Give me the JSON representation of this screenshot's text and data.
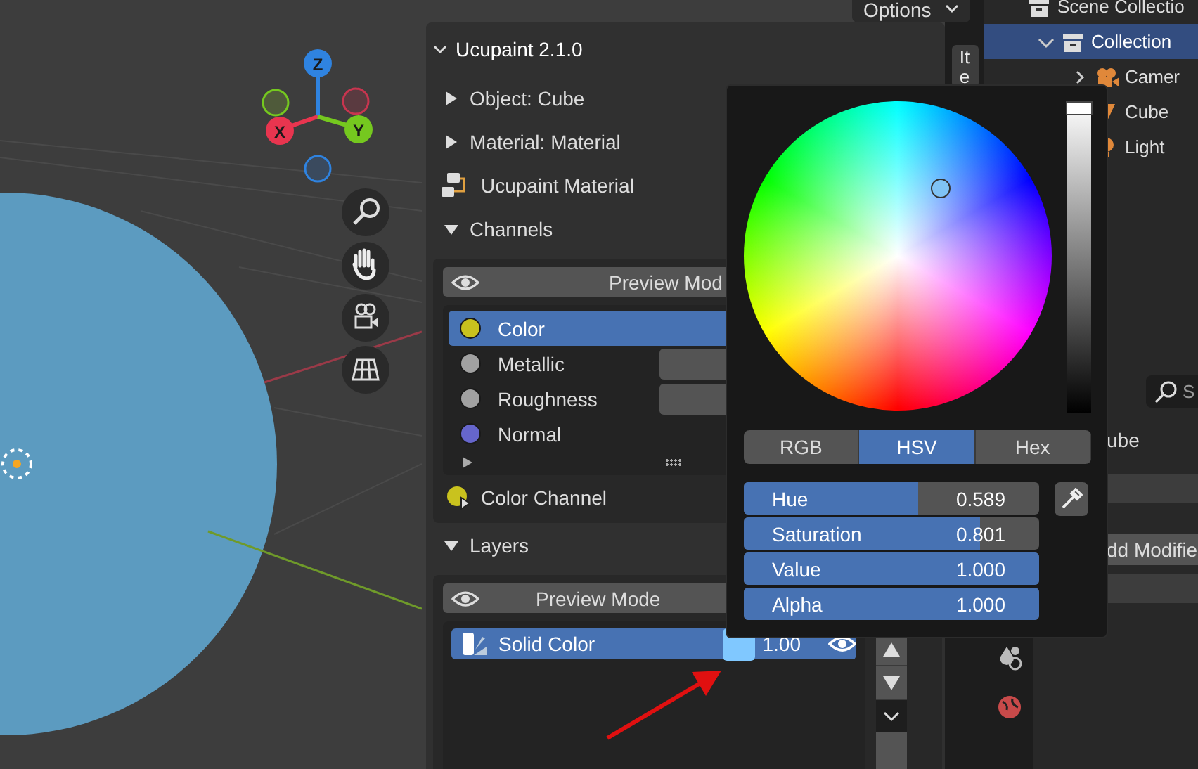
{
  "viewport": {
    "gizmo_axes": [
      {
        "label": "Z",
        "color": "#2f83e0"
      },
      {
        "label": "X",
        "color": "#e8354f"
      },
      {
        "label": "Y",
        "color": "#75c81f"
      }
    ]
  },
  "header": {
    "options_label": "Options"
  },
  "sidebar_tab": {
    "label": "Ite",
    "selected": true
  },
  "panel": {
    "title": "Ucupaint 2.1.0",
    "expanded": true,
    "sections": [
      {
        "label": "Object: Cube",
        "expanded": false
      },
      {
        "label": "Material: Material",
        "expanded": false
      }
    ],
    "material_label": "Ucupaint Material",
    "channels": {
      "label": "Channels",
      "expanded": true,
      "preview_button": "Preview Mod",
      "items": [
        {
          "name": "Color",
          "color": "#c9c21e",
          "selected": true,
          "value_field": false
        },
        {
          "name": "Metallic",
          "color": "#a1a1a1",
          "selected": false,
          "value_field": true
        },
        {
          "name": "Roughness",
          "color": "#a1a1a1",
          "selected": false,
          "value_field": true
        },
        {
          "name": "Normal",
          "color": "#6666cc",
          "selected": false,
          "value_field": false
        }
      ],
      "active_label": "Color Channel"
    },
    "layers": {
      "label": "Layers",
      "expanded": true,
      "preview_button": "Preview Mode",
      "items": [
        {
          "name": "Solid Color",
          "selected": true,
          "color": "#80c8ff",
          "opacity": "1.00",
          "visible": true
        }
      ]
    }
  },
  "color_picker": {
    "modes": [
      {
        "label": "RGB",
        "selected": false
      },
      {
        "label": "HSV",
        "selected": true
      },
      {
        "label": "Hex",
        "selected": false
      }
    ],
    "sliders": [
      {
        "label": "Hue",
        "value": "0.589",
        "level": 0.589
      },
      {
        "label": "Saturation",
        "value": "0.801",
        "level": 0.801
      },
      {
        "label": "Value",
        "value": "1.000",
        "level": 1
      },
      {
        "label": "Alpha",
        "value": "1.000",
        "level": 1
      }
    ]
  },
  "outliner": {
    "items": [
      {
        "label": "Scene Collectio",
        "kind": "scene",
        "selected": false,
        "children": [
          {
            "label": "Collection",
            "kind": "collection",
            "selected": true,
            "expanded": true,
            "children": [
              {
                "label": "Camer",
                "kind": "camera",
                "selected": false,
                "expanded": false
              },
              {
                "label": "Cube",
                "kind": "mesh",
                "selected": false
              },
              {
                "label": "Light",
                "kind": "light",
                "selected": false
              }
            ]
          }
        ]
      }
    ]
  },
  "properties": {
    "search_placeholder": "S",
    "object_name": "ube",
    "add_button": "dd Modifie"
  }
}
